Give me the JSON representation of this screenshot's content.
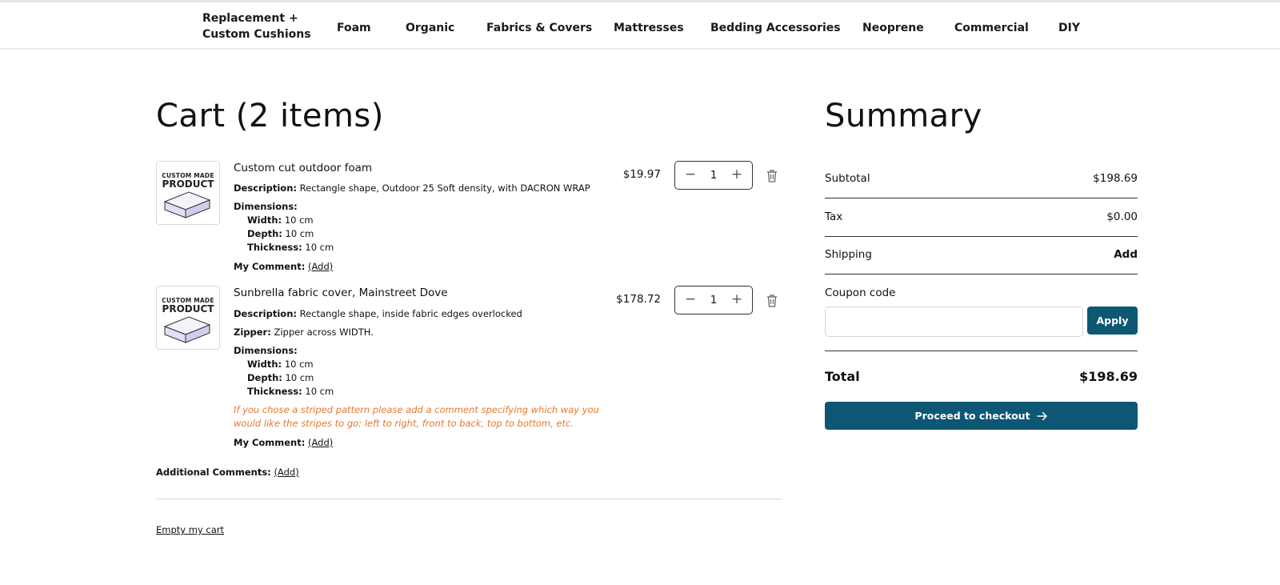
{
  "nav": {
    "items": [
      {
        "label": "Replacement + Custom Cushions"
      },
      {
        "label": "Foam"
      },
      {
        "label": "Organic"
      },
      {
        "label": "Fabrics & Covers"
      },
      {
        "label": "Mattresses"
      },
      {
        "label": "Bedding Accessories"
      },
      {
        "label": "Neoprene"
      },
      {
        "label": "Commercial"
      },
      {
        "label": "DIY"
      }
    ]
  },
  "cart": {
    "title": "Cart (2 items)",
    "thumb_line1": "CUSTOM MADE",
    "thumb_line2": "PRODUCT",
    "items": [
      {
        "title": "Custom cut outdoor foam",
        "price": "$19.97",
        "quantity": "1",
        "description_label": "Description:",
        "description": "Rectangle shape, Outdoor 25 Soft density, with DACRON WRAP",
        "dimensions_label": "Dimensions:",
        "width_label": "Width:",
        "width": "10 cm",
        "depth_label": "Depth:",
        "depth": "10 cm",
        "thickness_label": "Thickness:",
        "thickness": "10 cm",
        "comment_label": "My Comment:",
        "comment_link": "(Add)"
      },
      {
        "title": "Sunbrella fabric cover, Mainstreet Dove",
        "price": "$178.72",
        "quantity": "1",
        "description_label": "Description:",
        "description": "Rectangle shape, inside fabric edges overlocked",
        "zipper_label": "Zipper:",
        "zipper": "Zipper across WIDTH.",
        "dimensions_label": "Dimensions:",
        "width_label": "Width:",
        "width": "10 cm",
        "depth_label": "Depth:",
        "depth": "10 cm",
        "thickness_label": "Thickness:",
        "thickness": "10 cm",
        "note": "If you chose a striped pattern please add a comment specifying which way you would like the stripes to go: left to right, front to back, top to bottom, etc.",
        "comment_label": "My Comment:",
        "comment_link": "(Add)"
      }
    ],
    "additional_label": "Additional Comments:",
    "additional_link": "(Add)",
    "empty_link": "Empty my cart"
  },
  "summary": {
    "title": "Summary",
    "subtotal_label": "Subtotal",
    "subtotal_value": "$198.69",
    "tax_label": "Tax",
    "tax_value": "$0.00",
    "shipping_label": "Shipping",
    "shipping_value": "Add",
    "coupon_label": "Coupon code",
    "coupon_value": "",
    "apply_label": "Apply",
    "total_label": "Total",
    "total_value": "$198.69",
    "checkout_label": "Proceed to checkout"
  },
  "colors": {
    "primary": "#0e5774",
    "note": "#e8772e"
  },
  "icons": {
    "trash": "trash-icon",
    "arrow": "arrow-right-icon",
    "minus": "minus-icon",
    "plus": "plus-icon"
  }
}
